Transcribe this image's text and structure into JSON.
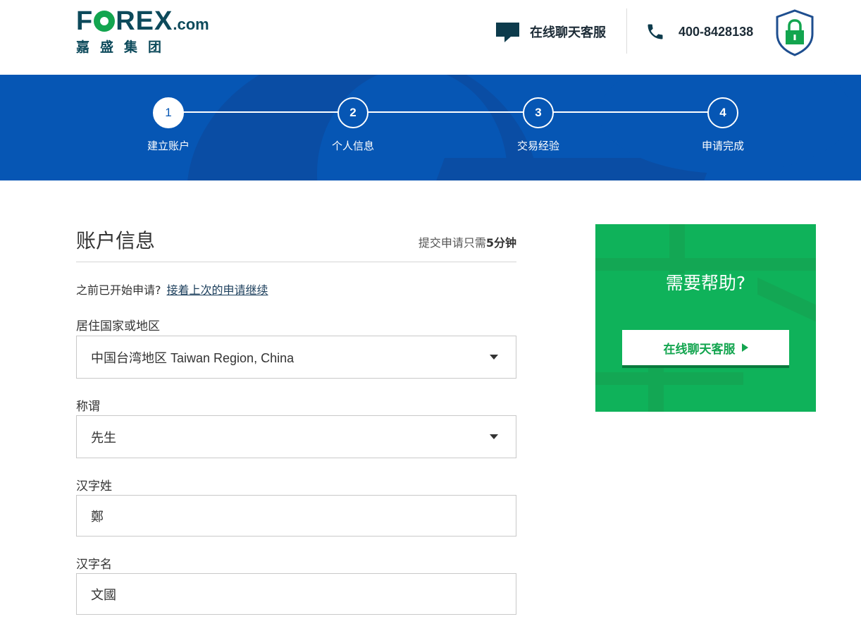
{
  "header": {
    "logo_text": "FOREX",
    "logo_domain": ".com",
    "logo_subtitle": "嘉盛集团",
    "chat_label": "在线聊天客服",
    "phone": "400-8428138",
    "icons": [
      "chat-icon",
      "phone-icon",
      "lock-shield-icon"
    ]
  },
  "steps": [
    {
      "number": "1",
      "label": "建立账户",
      "active": true
    },
    {
      "number": "2",
      "label": "个人信息",
      "active": false
    },
    {
      "number": "3",
      "label": "交易经验",
      "active": false
    },
    {
      "number": "4",
      "label": "申请完成",
      "active": false
    }
  ],
  "form": {
    "title": "账户信息",
    "time_prefix": "提交申请只需",
    "time_value": "5分钟",
    "resume_prompt": "之前已开始申请?",
    "resume_link": "接着上次的申请继续",
    "fields": [
      {
        "label": "居住国家或地区",
        "value": "中国台湾地区 Taiwan Region, China",
        "type": "select"
      },
      {
        "label": "称谓",
        "value": "先生",
        "type": "select"
      },
      {
        "label": "汉字姓",
        "value": "鄭",
        "type": "text"
      },
      {
        "label": "汉字名",
        "value": "文國",
        "type": "text"
      }
    ]
  },
  "help": {
    "title": "需要帮助?",
    "button_label": "在线聊天客服"
  },
  "colors": {
    "brand_dark": "#0d4a5b",
    "brand_green": "#13a54f",
    "band_blue": "#0656b4",
    "help_green": "#0fb25a"
  }
}
